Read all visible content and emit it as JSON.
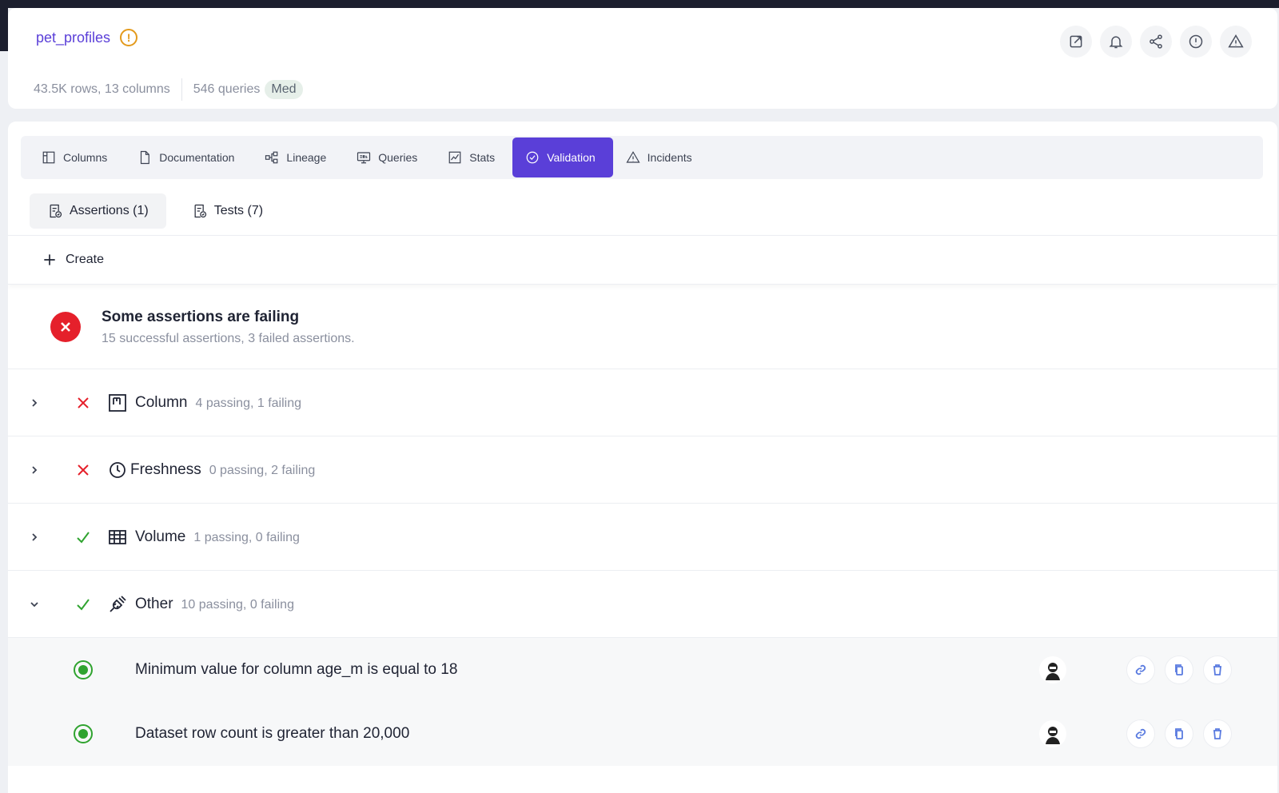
{
  "dataset": {
    "name": "pet_profiles",
    "rows_columns": "43.5K rows, 13 columns",
    "queries": "546 queries",
    "usage_badge": "Med"
  },
  "header_actions": [
    "open-external-icon",
    "bell-icon",
    "share-icon",
    "info-circle-icon",
    "warning-triangle-icon"
  ],
  "tabs": [
    {
      "label": "Columns",
      "icon": "columns-icon"
    },
    {
      "label": "Documentation",
      "icon": "document-icon"
    },
    {
      "label": "Lineage",
      "icon": "lineage-icon"
    },
    {
      "label": "Queries",
      "icon": "sql-icon"
    },
    {
      "label": "Stats",
      "icon": "chart-icon"
    },
    {
      "label": "Validation",
      "icon": "check-circle-icon",
      "active": true
    },
    {
      "label": "Incidents",
      "icon": "warning-icon"
    }
  ],
  "subtabs": [
    {
      "label": "Assertions (1)",
      "active": true
    },
    {
      "label": "Tests (7)",
      "active": false
    }
  ],
  "create_label": "Create",
  "summary": {
    "title": "Some assertions are failing",
    "subtitle": "15 successful assertions, 3 failed assertions."
  },
  "groups": [
    {
      "label": "Column",
      "count": "4 passing, 1 failing",
      "status": "fail",
      "expanded": false
    },
    {
      "label": "Freshness",
      "count": "0 passing, 2 failing",
      "status": "fail",
      "expanded": false
    },
    {
      "label": "Volume",
      "count": "1 passing, 0 failing",
      "status": "pass",
      "expanded": false
    },
    {
      "label": "Other",
      "count": "10 passing, 0 failing",
      "status": "pass",
      "expanded": true
    }
  ],
  "assertions": [
    {
      "text": "Minimum value for column age_m is equal to 18",
      "status": "passing"
    },
    {
      "text": "Dataset row count is greater than 20,000",
      "status": "passing"
    }
  ],
  "colors": {
    "accent": "#5a3fd8",
    "fail": "#e5202b",
    "pass": "#2fa32f",
    "warning": "#e39a1c"
  }
}
